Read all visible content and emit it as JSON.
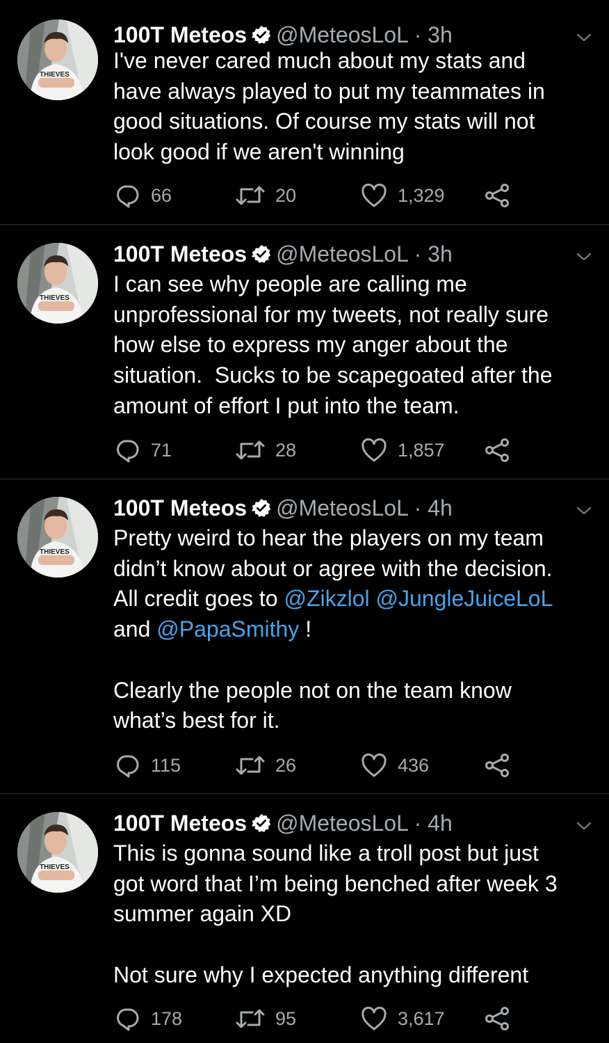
{
  "colors": {
    "background": "#000000",
    "text": "#ffffff",
    "muted": "#a5abb0",
    "link": "#4aa2e9",
    "separator": "#2f3336"
  },
  "icons": {
    "reply": "reply-icon",
    "retweet": "retweet-icon",
    "like": "heart-icon",
    "share": "share-icon",
    "verified": "verified-badge-icon",
    "menu": "chevron-down-icon"
  },
  "tweets": [
    {
      "name": "100T Meteos",
      "handle": "@MeteosLoL",
      "dot": "·",
      "time": "3h",
      "text": "I've never cared much about my stats and\nhave always played to put my teammates in\ngood situations. Of course my stats will not\nlook good if we aren't winning",
      "replies": "66",
      "retweets": "20",
      "likes": "1,329"
    },
    {
      "name": "100T Meteos",
      "handle": "@MeteosLoL",
      "dot": "·",
      "time": "3h",
      "text": "I can see why people are calling me\nunprofessional for my tweets, not really sure\nhow else to express my anger about the\nsituation.  Sucks to be scapegoated after the\namount of effort I put into the team.",
      "replies": "71",
      "retweets": "28",
      "likes": "1,857"
    },
    {
      "name": "100T Meteos",
      "handle": "@MeteosLoL",
      "dot": "·",
      "time": "4h",
      "text_line1": "Pretty weird to hear the players on my team",
      "text_line2": "didn’t know about or agree with the decision.",
      "text_line3": "All credit goes to ",
      "mention1": "@Zikzlol",
      "mention2": "@JungleJuiceLoL",
      "text_and": "and ",
      "mention3": "@PapaSmithy",
      "text_excl": " !",
      "text_para2": "Clearly the people not on the team know\nwhat’s best for it.",
      "replies": "115",
      "retweets": "26",
      "likes": "436"
    },
    {
      "name": "100T Meteos",
      "handle": "@MeteosLoL",
      "dot": "·",
      "time": "4h",
      "text": "This is gonna sound like a troll post but just\ngot word that I’m being benched after week 3\nsummer again XD\n\nNot sure why I expected anything different",
      "replies": "178",
      "retweets": "95",
      "likes": "3,617"
    }
  ]
}
